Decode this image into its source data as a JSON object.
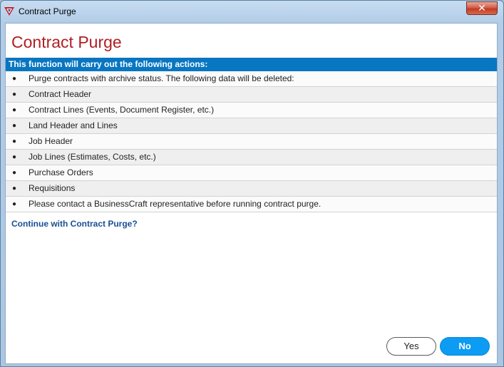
{
  "window": {
    "title": "Contract Purge",
    "close_glyph": "✕"
  },
  "dialog": {
    "heading": "Contract Purge",
    "banner": "This function will carry out the following actions:",
    "items": [
      "Purge contracts with archive status. The following data will be deleted:",
      "Contract Header",
      "Contract Lines (Events, Document Register, etc.)",
      "Land Header and Lines",
      "Job Header",
      "Job Lines (Estimates, Costs, etc.)",
      "Purchase Orders",
      "Requisitions",
      "Please contact a BusinessCraft representative before running contract purge."
    ],
    "bullet": "●",
    "question": "Continue with Contract Purge?",
    "yes_label": "Yes",
    "no_label": "No"
  },
  "colors": {
    "heading": "#b01f24",
    "banner": "#0876c1",
    "question": "#1a4f92",
    "primary_button": "#0c9cf3"
  },
  "icons": {
    "app": "businesscraft-logo-icon",
    "close": "close-icon"
  }
}
